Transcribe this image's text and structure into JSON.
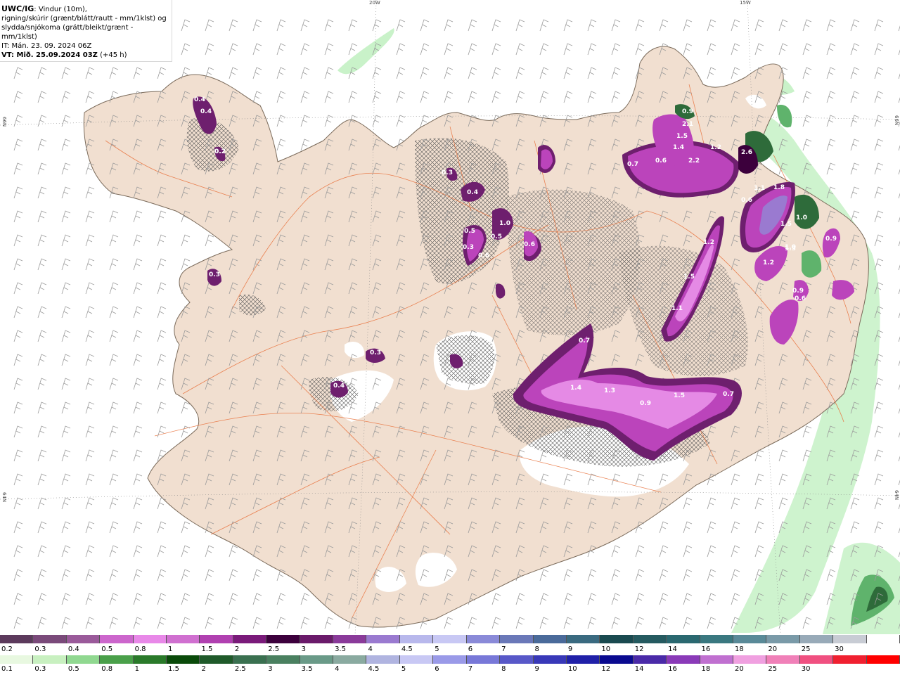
{
  "title": {
    "model": "UWC/IG",
    "desc_1": ": Vindur (10m),",
    "desc_2": "rigning/skúrir (grænt/blátt/rautt - mm/1klst) og",
    "desc_3": "slydda/snjókoma (grátt/bleikt/grænt - mm/1klst)",
    "it": "IT: Mán. 23. 09. 2024 06Z",
    "vt": "VT: Mið. 25.09.2024 03Z",
    "vt_offset": " (+45 h)"
  },
  "graticule": {
    "lon_20w": "20W",
    "lon_15w": "15W",
    "lat_66n_left": "66N",
    "lat_66n_right": "66N",
    "lat_64n_left": "64N",
    "lat_64n_right": "64N"
  },
  "colors": {
    "land": "#f1dfd0",
    "coast": "#7a6a5a",
    "roads": "#e8703a",
    "glacier": "#ffffff",
    "wind_barb": "#9a9a9a",
    "rain_light": "#c9f2c9",
    "rain_mid": "#5fb36c",
    "rain_dark": "#2e6b3a",
    "snow_light": "#e58ae5",
    "snow_mid": "#bb44bb",
    "snow_dark": "#6e1f6e"
  },
  "precip_labels": [
    "0.4",
    "0.4",
    "0.2",
    "0.3",
    "0.4",
    "0.3",
    "0.5",
    "0.9",
    "2.1",
    "1.4",
    "1.5",
    "1.2",
    "2.2",
    "0.7",
    "0.6",
    "2.6",
    "1.8",
    "1.1",
    "0.6",
    "1.0",
    "1.5",
    "1.0",
    "1.3",
    "1.2",
    "0.9",
    "1.2",
    "1.5",
    "1.1",
    "0.9",
    "0.6",
    "0.7",
    "1.4",
    "1.3",
    "0.9",
    "1.5",
    "0.7",
    "0.4",
    "0.3",
    "0.6",
    "1.0",
    "0.5",
    "0.6",
    "0.3",
    "0.2"
  ],
  "legend_snow": {
    "colors": [
      "#5c3a5c",
      "#7a4a7a",
      "#9a5a9a",
      "#cc66cc",
      "#e888e8",
      "#d070d0",
      "#b040b0",
      "#7a1a7a",
      "#3c003c",
      "#6a1a6a",
      "#8a3a9a",
      "#9a7ad0",
      "#b8b8ec",
      "#c8c8f4",
      "#8a8ad8",
      "#6a78b8",
      "#4a6a9a",
      "#3a6a80",
      "#1a4a50",
      "#255a60",
      "#2a6870",
      "#3a7880",
      "#5a8a98",
      "#7a9aa8",
      "#98aab8",
      "#c8ccd4",
      "#ffffff"
    ],
    "labels": [
      "0.2",
      "0.3",
      "0.4",
      "0.5",
      "0.8",
      "1",
      "1.5",
      "2",
      "2.5",
      "3",
      "3.5",
      "4",
      "4.5",
      "5",
      "6",
      "7",
      "8",
      "9",
      "10",
      "12",
      "14",
      "16",
      "18",
      "20",
      "25",
      "30"
    ]
  },
  "legend_rain": {
    "colors": [
      "#e8f8e0",
      "#c8f0c0",
      "#90d890",
      "#4aa04a",
      "#2a7a2a",
      "#0a4a0a",
      "#1f5a2a",
      "#3a7050",
      "#4a8060",
      "#6a9a88",
      "#8aaaa0",
      "#b0b4e0",
      "#c8c8f4",
      "#9a9ae8",
      "#7878d8",
      "#5858c8",
      "#3838b8",
      "#2020a8",
      "#0a0a90",
      "#4a2aa8",
      "#8a3ab8",
      "#c070d0",
      "#f0a0e0",
      "#f080b8",
      "#f05080",
      "#f02030",
      "#ff0000"
    ],
    "labels": [
      "0.1",
      "0.3",
      "0.5",
      "0.8",
      "1",
      "1.5",
      "2",
      "2.5",
      "3",
      "3.5",
      "4",
      "4.5",
      "5",
      "6",
      "7",
      "8",
      "9",
      "10",
      "12",
      "14",
      "16",
      "18",
      "20",
      "25",
      "30"
    ]
  }
}
